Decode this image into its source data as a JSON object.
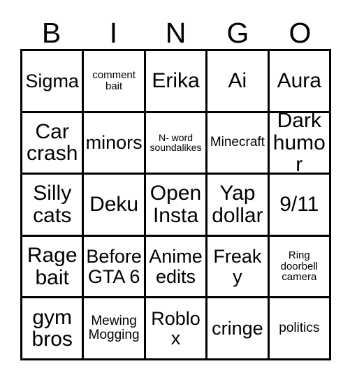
{
  "header": {
    "letters": [
      "B",
      "I",
      "N",
      "G",
      "O"
    ]
  },
  "grid": {
    "rows": [
      [
        {
          "text": "Sigma",
          "size": "fs-lg"
        },
        {
          "text": "comment\nbait",
          "size": "fs-sm"
        },
        {
          "text": "Erika",
          "size": "fs-xl"
        },
        {
          "text": "Ai",
          "size": "fs-xl"
        },
        {
          "text": "Aura",
          "size": "fs-xl"
        }
      ],
      [
        {
          "text": "Car\ncrash",
          "size": "fs-xl"
        },
        {
          "text": "minors",
          "size": "fs-lg"
        },
        {
          "text": "N- word\nsoundalikes",
          "size": "fs-xs"
        },
        {
          "text": "Minecraft",
          "size": "fs-md"
        },
        {
          "text": "Dark\nhumor",
          "size": "fs-xl"
        }
      ],
      [
        {
          "text": "Silly\ncats",
          "size": "fs-xl"
        },
        {
          "text": "Deku",
          "size": "fs-xl"
        },
        {
          "text": "Open\nInsta",
          "size": "fs-xl"
        },
        {
          "text": "Yap\ndollar",
          "size": "fs-xl"
        },
        {
          "text": "9/11",
          "size": "fs-xl"
        }
      ],
      [
        {
          "text": "Rage\nbait",
          "size": "fs-xl"
        },
        {
          "text": "Before\nGTA 6",
          "size": "fs-lg"
        },
        {
          "text": "Anime\nedits",
          "size": "fs-lg"
        },
        {
          "text": "Freaky",
          "size": "fs-lg"
        },
        {
          "text": "Ring\ndoorbell\ncamera",
          "size": "fs-sm"
        }
      ],
      [
        {
          "text": "gym\nbros",
          "size": "fs-xl"
        },
        {
          "text": "Mewing\nMogging",
          "size": "fs-md"
        },
        {
          "text": "Roblox",
          "size": "fs-lg"
        },
        {
          "text": "cringe",
          "size": "fs-lg"
        },
        {
          "text": "politics",
          "size": "fs-md"
        }
      ]
    ]
  },
  "colors": {
    "border": "#000000",
    "text": "#000000",
    "background": "#ffffff"
  }
}
